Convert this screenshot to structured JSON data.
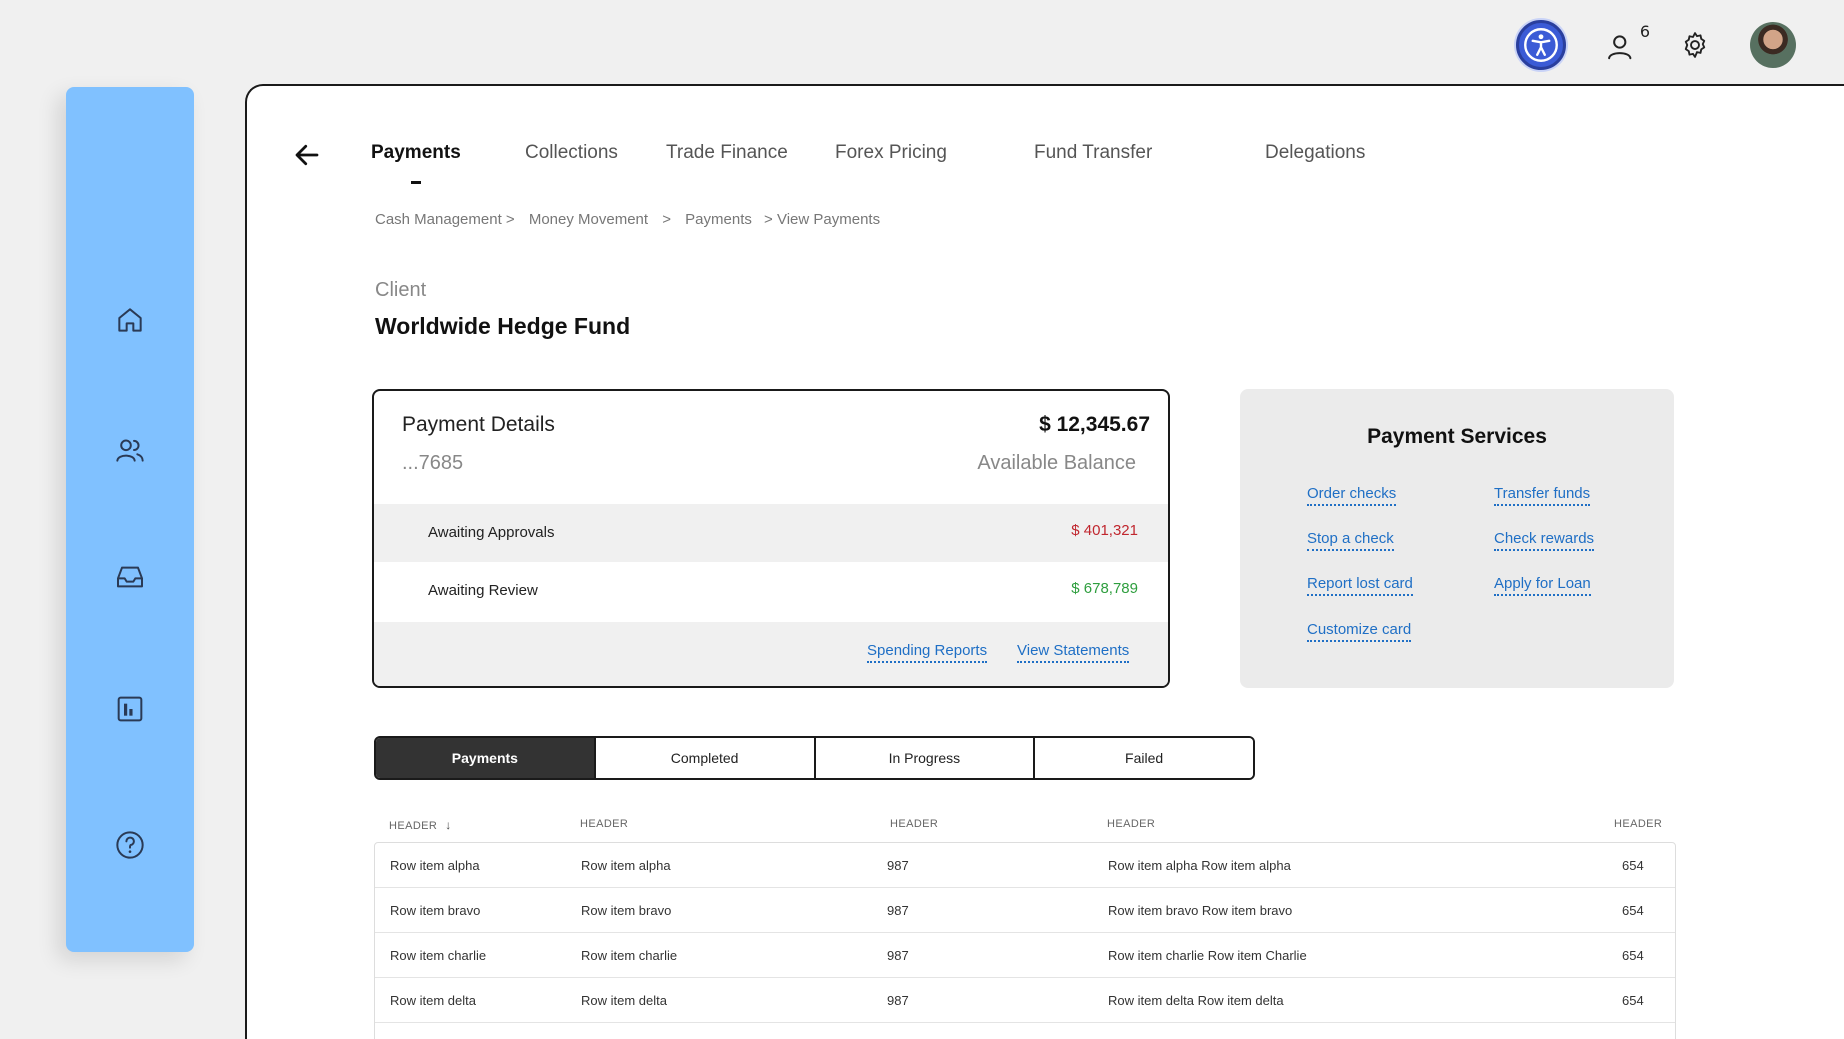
{
  "topbar": {
    "notification_count": "6",
    "icons": [
      "accessibility-icon",
      "users-icon",
      "gear-icon",
      "avatar"
    ]
  },
  "sidebar": {
    "items": [
      {
        "icon": "home-icon"
      },
      {
        "icon": "users-icon"
      },
      {
        "icon": "inbox-icon"
      },
      {
        "icon": "report-icon"
      },
      {
        "icon": "help-icon"
      }
    ],
    "color": "#80c1ff"
  },
  "tabs": [
    {
      "label": "Payments",
      "active": true
    },
    {
      "label": "Collections"
    },
    {
      "label": "Trade Finance"
    },
    {
      "label": "Forex Pricing"
    },
    {
      "label": "Fund Transfer"
    },
    {
      "label": "Delegations"
    }
  ],
  "breadcrumb": [
    "Cash Management >",
    "Money Movement",
    ">",
    "Payments",
    "> View Payments"
  ],
  "client": {
    "label": "Client",
    "name": "Worldwide Hedge Fund"
  },
  "payment_details": {
    "title": "Payment Details",
    "amount": "$ 12,345.67",
    "account": "...7685",
    "balance_label": "Available Balance",
    "rows": [
      {
        "label": "Awaiting Approvals",
        "value": "$ 401,321",
        "color": "#c0262e"
      },
      {
        "label": "Awaiting Review",
        "value": "$ 678,789",
        "color": "#2e9e3e"
      }
    ],
    "links": [
      "Spending Reports",
      "View Statements"
    ]
  },
  "payment_services": {
    "title": "Payment Services",
    "links": [
      "Order checks",
      "Transfer funds",
      "Stop a check",
      "Check rewards",
      "Report lost card",
      "Apply for Loan",
      "Customize card"
    ]
  },
  "filters": [
    "Payments",
    "Completed",
    "In Progress",
    "Failed"
  ],
  "table": {
    "headers": [
      "HEADER",
      "HEADER",
      "HEADER",
      "HEADER",
      "HEADER"
    ],
    "rows": [
      [
        "Row item alpha",
        "Row item alpha",
        "987",
        "Row item alpha Row item alpha",
        "654"
      ],
      [
        "Row item bravo",
        "Row item bravo",
        "987",
        "Row item bravo Row item bravo",
        "654"
      ],
      [
        "Row item charlie",
        "Row item charlie",
        "987",
        "Row item charlie Row item Charlie",
        "654"
      ],
      [
        "Row item delta",
        "Row item delta",
        "987",
        "Row item delta Row item delta",
        "654"
      ]
    ]
  }
}
